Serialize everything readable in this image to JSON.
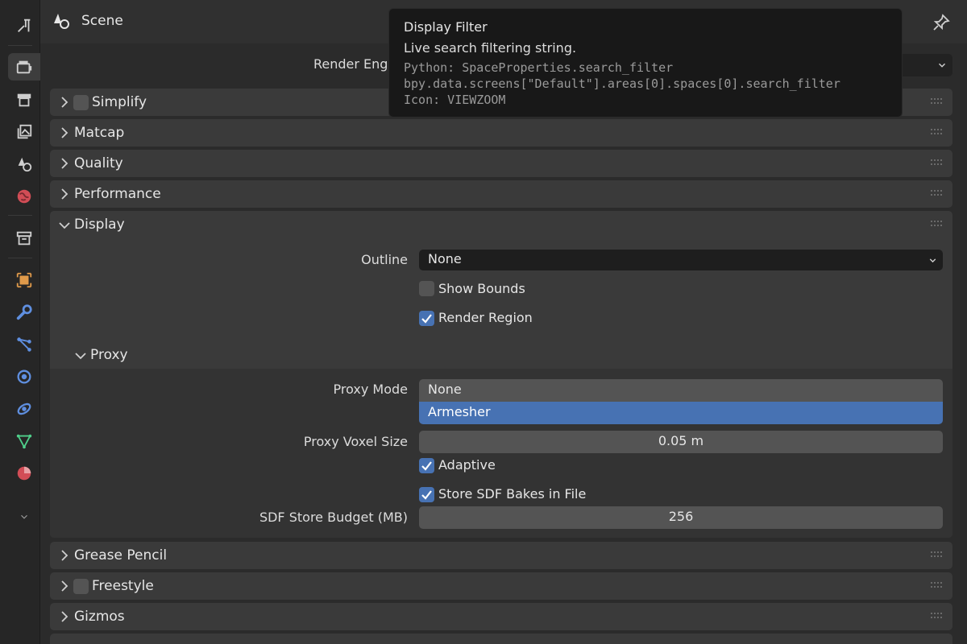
{
  "header": {
    "title": "Scene",
    "render_engine_label": "Render Eng"
  },
  "tabs": [
    {
      "name": "tool-tab-icon",
      "color": "#cfcfcf"
    },
    {
      "name": "render-tab-icon",
      "color": "#cfcfcf",
      "active": true
    },
    {
      "name": "output-tab-icon",
      "color": "#cfcfcf"
    },
    {
      "name": "view-layer-tab-icon",
      "color": "#cfcfcf"
    },
    {
      "name": "scene-tab-icon",
      "color": "#cfcfcf"
    },
    {
      "name": "world-tab-icon",
      "color": "#d24d56"
    },
    {
      "name": "collection-tab-icon",
      "color": "#cfcfcf"
    },
    {
      "name": "object-tab-icon",
      "color": "#e09a4a"
    },
    {
      "name": "modifier-tab-icon",
      "color": "#5f8fe0"
    },
    {
      "name": "particles-tab-icon",
      "color": "#5f8fe0"
    },
    {
      "name": "physics-tab-icon",
      "color": "#5f8fe0"
    },
    {
      "name": "constraints-tab-icon",
      "color": "#5f8fe0"
    },
    {
      "name": "data-tab-icon",
      "color": "#4fcf8a"
    },
    {
      "name": "material-tab-icon",
      "color": "#d24d56"
    }
  ],
  "panels": {
    "simplify": "Simplify",
    "matcap": "Matcap",
    "quality": "Quality",
    "performance": "Performance",
    "display": "Display",
    "grease_pencil": "Grease Pencil",
    "freestyle": "Freestyle",
    "gizmos": "Gizmos"
  },
  "display": {
    "outline_label": "Outline",
    "outline_value": "None",
    "show_bounds_label": "Show Bounds",
    "show_bounds_checked": false,
    "render_region_label": "Render Region",
    "render_region_checked": true
  },
  "proxy": {
    "title": "Proxy",
    "mode_label": "Proxy Mode",
    "mode_options": [
      "None",
      "Armesher"
    ],
    "mode_highlighted": "Armesher",
    "voxel_size_label": "Proxy Voxel Size",
    "voxel_size_value": "0.05 m",
    "adaptive_label": "Adaptive",
    "adaptive_checked": true,
    "store_sdf_label": "Store SDF Bakes in File",
    "store_sdf_checked": true,
    "sdf_budget_label": "SDF Store Budget (MB)",
    "sdf_budget_value": "256"
  },
  "tooltip": {
    "title": "Display Filter",
    "description": "Live search filtering string.",
    "python": "Python: SpaceProperties.search_filter",
    "path": "bpy.data.screens[\"Default\"].areas[0].spaces[0].search_filter",
    "icon": "Icon: VIEWZOOM"
  },
  "colors": {
    "accent": "#4772b3",
    "panel": "#3a3a3a",
    "background": "#2b2b2b"
  }
}
